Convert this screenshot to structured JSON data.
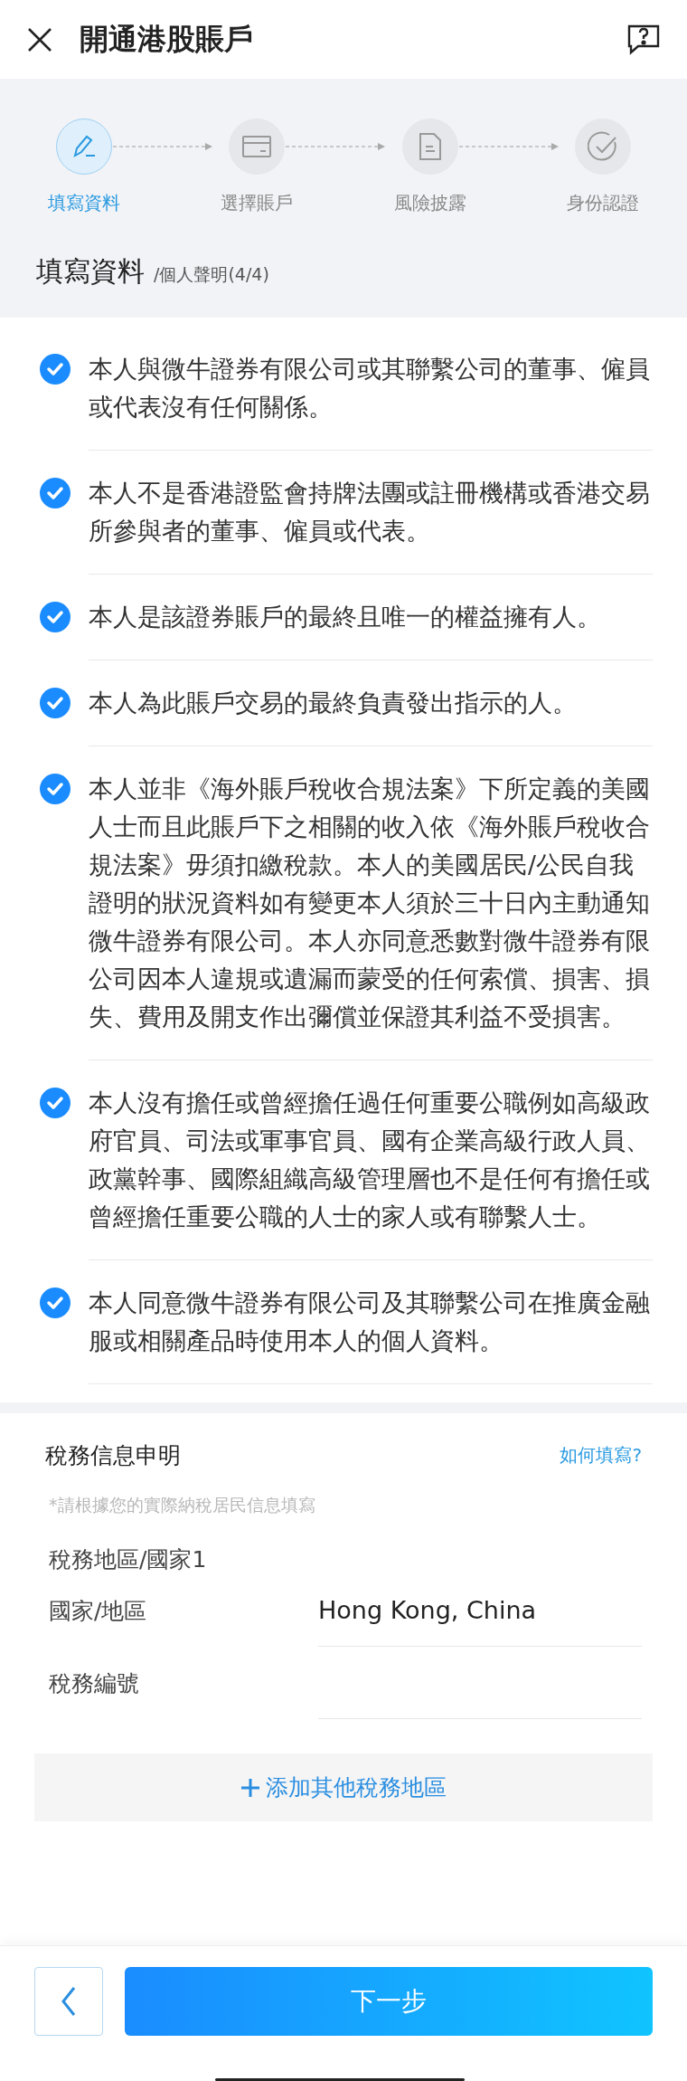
{
  "header": {
    "title": "開通港股賬戶"
  },
  "steps": [
    {
      "label": "填寫資料",
      "selected": true,
      "kind": "pen"
    },
    {
      "label": "選擇賬戶",
      "selected": false,
      "kind": "card"
    },
    {
      "label": "風險披露",
      "selected": false,
      "kind": "doc"
    },
    {
      "label": "身份認證",
      "selected": false,
      "kind": "check"
    }
  ],
  "section": {
    "title": "填寫資料",
    "subtitle": "/個人聲明(4/4)"
  },
  "declarations": [
    {
      "checked": true,
      "text": "本人與微牛證券有限公司或其聯繫公司的董事、僱員或代表沒有任何關係。"
    },
    {
      "checked": true,
      "text": "本人不是香港證監會持牌法團或註冊機構或香港交易所參與者的董事、僱員或代表。"
    },
    {
      "checked": true,
      "text": "本人是該證券賬戶的最終且唯一的權益擁有人。"
    },
    {
      "checked": true,
      "text": "本人為此賬戶交易的最終負責發出指示的人。"
    },
    {
      "checked": true,
      "text": "本人並非《海外賬戶稅收合規法案》下所定義的美國人士而且此賬戶下之相關的收入依《海外賬戶稅收合規法案》毋須扣繳稅款。本人的美國居民/公民自我證明的狀況資料如有變更本人須於三十日內主動通知微牛證券有限公司。本人亦同意悉數對微牛證券有限公司因本人違規或遺漏而蒙受的任何索償、損害、損失、費用及開支作出彌償並保證其利益不受損害。"
    },
    {
      "checked": true,
      "text": "本人沒有擔任或曾經擔任過任何重要公職例如高級政府官員、司法或軍事官員、國有企業高級行政人員、政黨幹事、國際組織高級管理層也不是任何有擔任或曾經擔任重要公職的人士的家人或有聯繫人士。"
    },
    {
      "checked": true,
      "text": "本人同意微牛證券有限公司及其聯繫公司在推廣金融服或相關產品時使用本人的個人資料。"
    }
  ],
  "tax": {
    "title": "稅務信息申明",
    "help_link": "如何填寫?",
    "hint": "*請根據您的實際納稅居民信息填寫",
    "group_title": "稅務地區/國家1",
    "fields": [
      {
        "label": "國家/地區",
        "value": "Hong Kong, China"
      },
      {
        "label": "稅務編號"
      }
    ],
    "add_button": "添加其他稅務地區"
  },
  "footer": {
    "next_button": "下一步"
  }
}
